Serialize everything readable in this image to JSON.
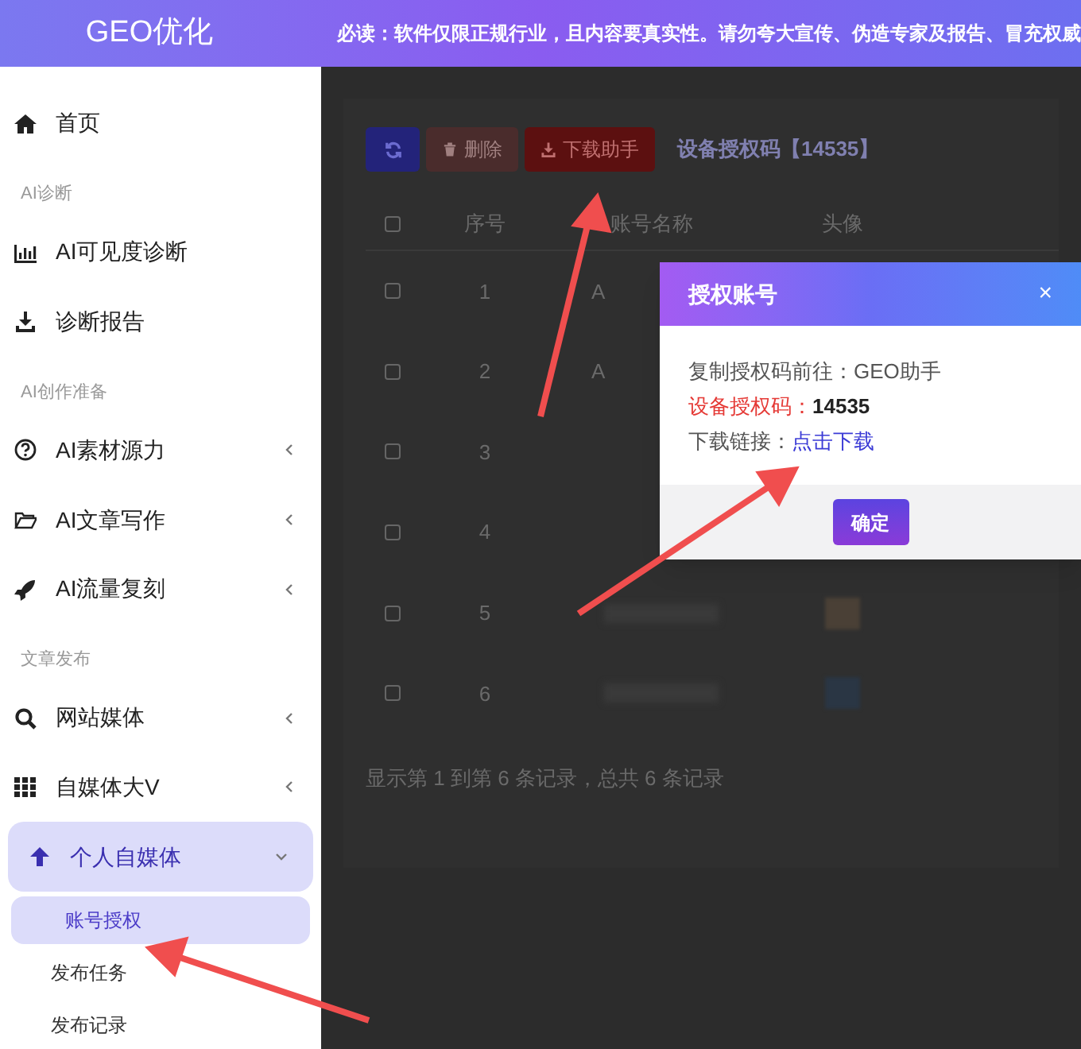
{
  "header": {
    "logo": "GEO优化",
    "notice": "必读：软件仅限正规行业，且内容要真实性。请勿夸大宣传、伪造专家及报告、冒充权威"
  },
  "sidebar": [
    {
      "kind": "item",
      "label": "首页"
    },
    {
      "kind": "section",
      "label": "AI诊断"
    },
    {
      "kind": "item",
      "label": "AI可见度诊断"
    },
    {
      "kind": "item",
      "label": "诊断报告"
    },
    {
      "kind": "section",
      "label": "AI创作准备"
    },
    {
      "kind": "item",
      "label": "AI素材源力",
      "expanded": false
    },
    {
      "kind": "item",
      "label": "AI文章写作",
      "expanded": false
    },
    {
      "kind": "item",
      "label": "AI流量复刻",
      "expanded": false
    },
    {
      "kind": "section",
      "label": "文章发布"
    },
    {
      "kind": "item",
      "label": "网站媒体",
      "expanded": false
    },
    {
      "kind": "item",
      "label": "自媒体大V",
      "expanded": false
    },
    {
      "kind": "item",
      "label": "个人自媒体",
      "expanded": true,
      "children": [
        {
          "label": "账号授权",
          "selected": true
        },
        {
          "label": "发布任务",
          "selected": false
        },
        {
          "label": "发布记录",
          "selected": false
        }
      ]
    }
  ],
  "toolbar": {
    "buttons": [
      {
        "kind": "refresh"
      },
      {
        "kind": "delete",
        "label": "删除",
        "disabled": true
      },
      {
        "kind": "download",
        "label": "下载助手",
        "disabled": false
      }
    ],
    "code_label": "设备授权码【14535】"
  },
  "table": {
    "select_all": false,
    "columns": [
      "序号",
      "账号名称",
      "头像"
    ],
    "rows": [
      {
        "checked": false,
        "no": "1",
        "name": "A"
      },
      {
        "checked": false,
        "no": "2",
        "name": "A"
      },
      {
        "checked": false,
        "no": "3"
      },
      {
        "checked": false,
        "no": "4"
      },
      {
        "checked": false,
        "no": "5",
        "blurred": true
      },
      {
        "checked": false,
        "no": "6",
        "blurred": true
      }
    ],
    "footer": "显示第 1 到第 6 条记录，总共 6 条记录"
  },
  "dialog": {
    "title": "授权账号",
    "close": "×",
    "line_1": "复制授权码前往：GEO助手",
    "code_label": "设备授权码：",
    "code_value": "14535",
    "link_label": "下载链接：",
    "link": "点击下载",
    "ok": "确定"
  }
}
